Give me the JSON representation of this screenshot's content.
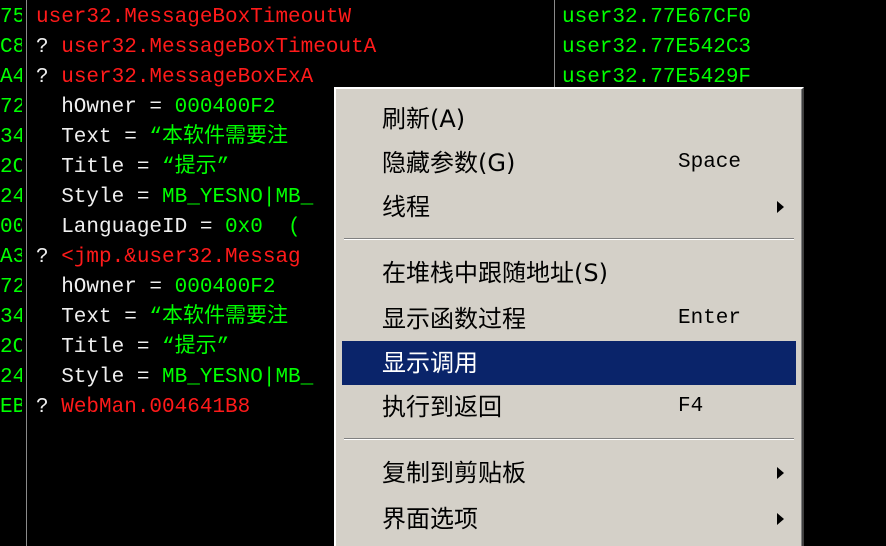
{
  "left_gutter": [
    "75",
    "C8",
    "A4",
    "72",
    "34",
    "2C",
    "24",
    "00",
    "A3",
    "72",
    "34",
    "2C",
    "24",
    "EB"
  ],
  "stack_rows": [
    {
      "prefix": "",
      "text": "user32.MessageBoxTimeoutW",
      "color": "red"
    },
    {
      "prefix": "? ",
      "text": "user32.MessageBoxTimeoutA",
      "color": "red"
    },
    {
      "prefix": "? ",
      "text": "user32.MessageBoxExA",
      "color": "red"
    },
    {
      "prefix": "  hOwner = ",
      "text": "000400F2",
      "color": "green"
    },
    {
      "prefix": "  Text = ",
      "text": "“本软件需要注",
      "color": "green"
    },
    {
      "prefix": "  Title = ",
      "text": "“提示”",
      "color": "green"
    },
    {
      "prefix": "  Style = ",
      "text": "MB_YESNO|MB_",
      "color": "green"
    },
    {
      "prefix": "  LanguageID = ",
      "text": "0x0  (",
      "color": "green"
    },
    {
      "prefix": "? ",
      "text": "<jmp.&user32.Messag",
      "color": "red"
    },
    {
      "prefix": "  hOwner = ",
      "text": "000400F2",
      "color": "green"
    },
    {
      "prefix": "  Text = ",
      "text": "“本软件需要注",
      "color": "green"
    },
    {
      "prefix": "  Title = ",
      "text": "“提示”",
      "color": "green"
    },
    {
      "prefix": "  Style = ",
      "text": "MB_YESNO|MB_",
      "color": "green"
    },
    {
      "prefix": "? ",
      "text": "WebMan.004641B8",
      "color": "red"
    }
  ],
  "right_rows": [
    "user32.77E67CF0",
    "user32.77E542C3",
    "user32.77E5429F"
  ],
  "menu": {
    "items": [
      {
        "label": "刷新(A)",
        "shortcut": "",
        "submenu": false,
        "highlighted": false
      },
      {
        "label": "隐藏参数(G)",
        "shortcut": "Space",
        "submenu": false,
        "highlighted": false
      },
      {
        "label": "线程",
        "shortcut": "",
        "submenu": true,
        "highlighted": false
      },
      {
        "label": "在堆栈中跟随地址(S)",
        "shortcut": "",
        "submenu": false,
        "highlighted": false
      },
      {
        "label": "显示函数过程",
        "shortcut": "Enter",
        "submenu": false,
        "highlighted": false
      },
      {
        "label": "显示调用",
        "shortcut": "",
        "submenu": false,
        "highlighted": true
      },
      {
        "label": "执行到返回",
        "shortcut": "F4",
        "submenu": false,
        "highlighted": false
      },
      {
        "label": "复制到剪贴板",
        "shortcut": "",
        "submenu": true,
        "highlighted": false
      },
      {
        "label": "界面选项",
        "shortcut": "",
        "submenu": true,
        "highlighted": false
      }
    ]
  },
  "colors": {
    "background": "#000000",
    "red": "#ff1a1a",
    "green": "#00ff00",
    "white": "#f0f0f0",
    "menu_bg": "#d4d0c8",
    "highlight": "#0a246a"
  }
}
